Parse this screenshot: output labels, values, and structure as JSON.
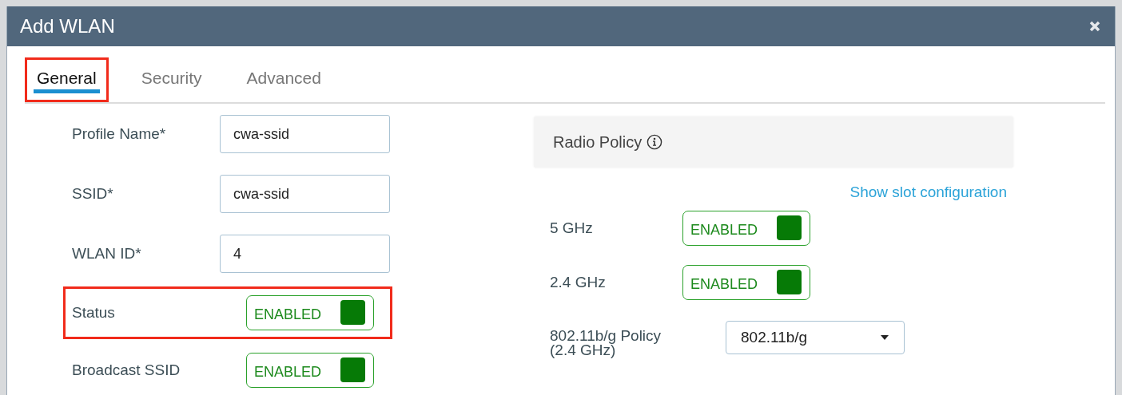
{
  "window": {
    "title": "Add WLAN"
  },
  "tabs": [
    {
      "label": "General",
      "selected": true,
      "highlighted": true
    },
    {
      "label": "Security",
      "selected": false,
      "highlighted": false
    },
    {
      "label": "Advanced",
      "selected": false,
      "highlighted": false
    }
  ],
  "general": [
    {
      "label": "Profile Name*",
      "kind": "text",
      "value": "cwa-ssid",
      "highlighted": false
    },
    {
      "label": "SSID*",
      "kind": "text",
      "value": "cwa-ssid",
      "highlighted": false
    },
    {
      "label": "WLAN ID*",
      "kind": "text",
      "value": "4",
      "highlighted": false
    },
    {
      "label": "Status",
      "kind": "toggle",
      "value": "ENABLED",
      "on": true,
      "highlighted": true
    },
    {
      "label": "Broadcast SSID",
      "kind": "toggle",
      "value": "ENABLED",
      "on": true,
      "highlighted": false
    }
  ],
  "radio_policy": {
    "title": "Radio Policy",
    "link": "Show slot configuration",
    "bands": [
      {
        "label": "5 GHz",
        "value": "ENABLED",
        "on": true
      },
      {
        "label": "2.4 GHz",
        "value": "ENABLED",
        "on": true
      }
    ],
    "policy": {
      "label": "802.11b/g Policy",
      "sublabel": "(2.4 GHz)",
      "value": "802.11b/g"
    }
  }
}
